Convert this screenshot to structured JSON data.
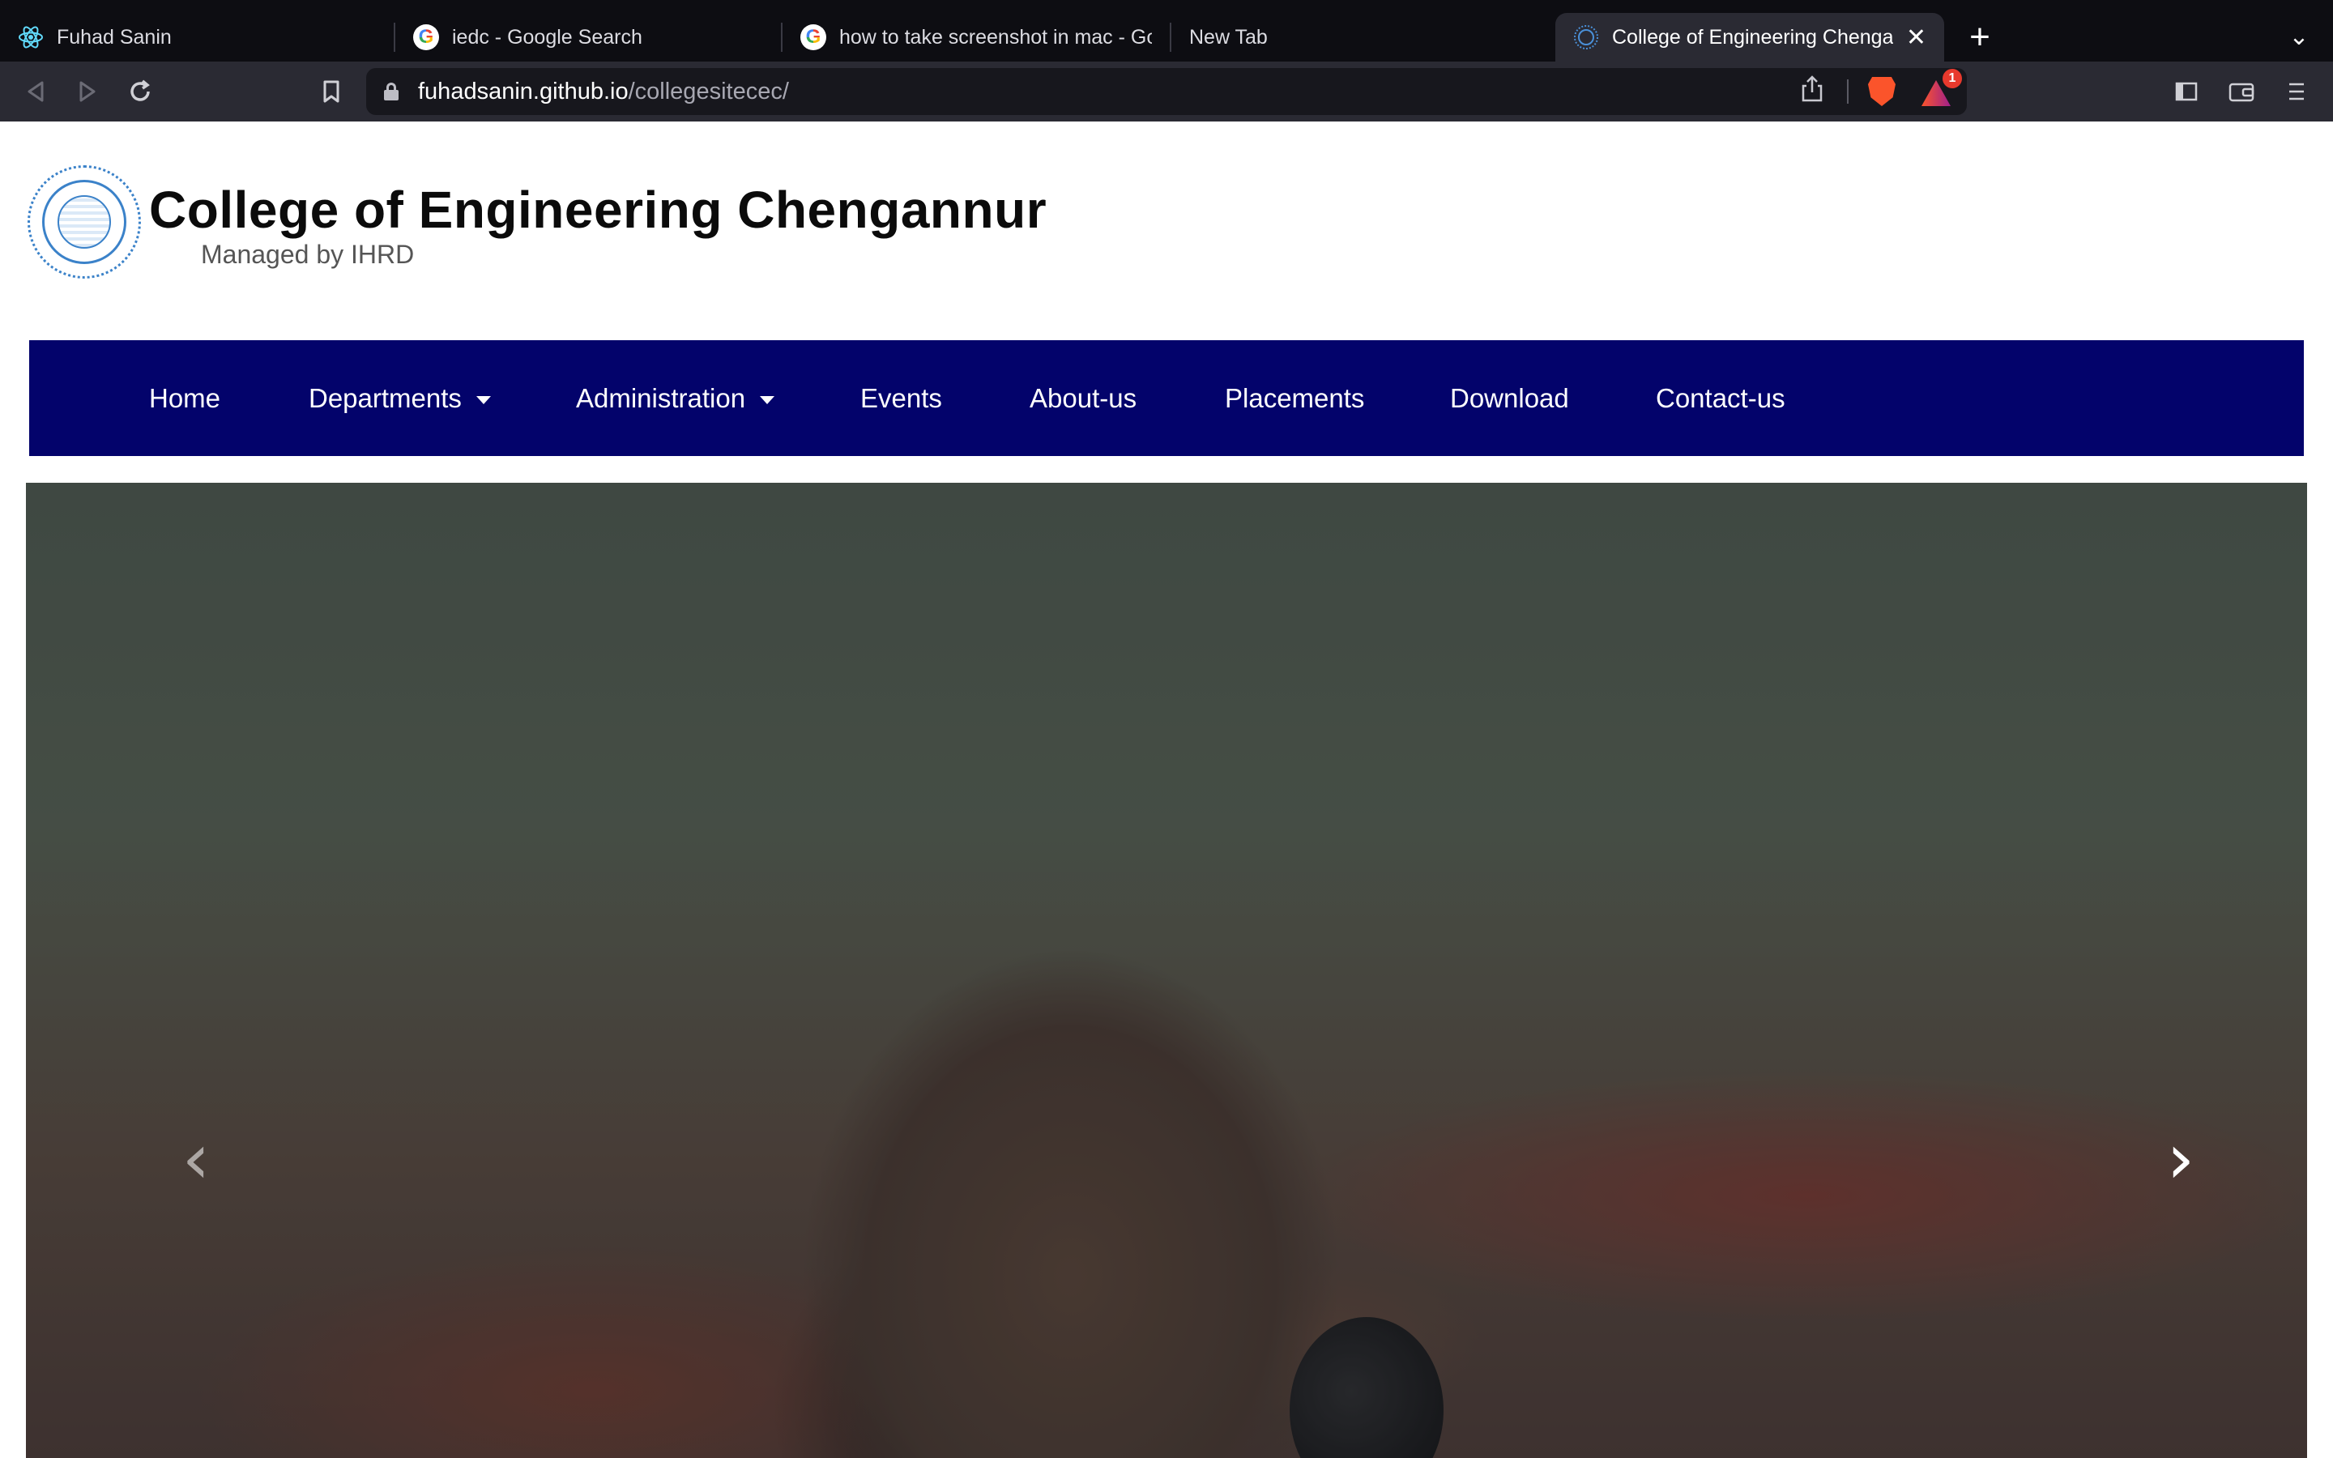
{
  "browser": {
    "tabs": [
      {
        "title": "Fuhad Sanin",
        "favicon": "react-icon",
        "active": false
      },
      {
        "title": "iedc - Google Search",
        "favicon": "google-icon",
        "active": false
      },
      {
        "title": "how to take screenshot in mac - Go",
        "favicon": "google-icon",
        "active": false
      },
      {
        "title": "New Tab",
        "favicon": "",
        "active": false
      },
      {
        "title": "College of Engineering Chengar",
        "favicon": "college-logo-icon",
        "active": true
      }
    ],
    "close_tab_glyph": "✕",
    "new_tab_glyph": "+",
    "tab_list_glyph": "⌄",
    "url_host": "fuhadsanin.github.io",
    "url_path": "/collegesitecec/",
    "rewards_badge": "1"
  },
  "header": {
    "title": "College of Engineering Chengannur",
    "subtitle": "Managed by IHRD"
  },
  "nav": {
    "items": [
      {
        "label": "Home"
      },
      {
        "label": "Departments",
        "dropdown": true
      },
      {
        "label": "Administration",
        "dropdown": true
      },
      {
        "label": "Events"
      },
      {
        "label": "About-us"
      },
      {
        "label": "Placements"
      },
      {
        "label": "Download"
      },
      {
        "label": "Contact-us"
      }
    ]
  },
  "carousel": {
    "prev_glyph": "‹",
    "next_glyph": "›"
  },
  "colors": {
    "navbar": "#03036b",
    "tab_strip": "#0d0d12",
    "toolbar": "#2a2a33",
    "logo_blue": "#3b82c9"
  }
}
